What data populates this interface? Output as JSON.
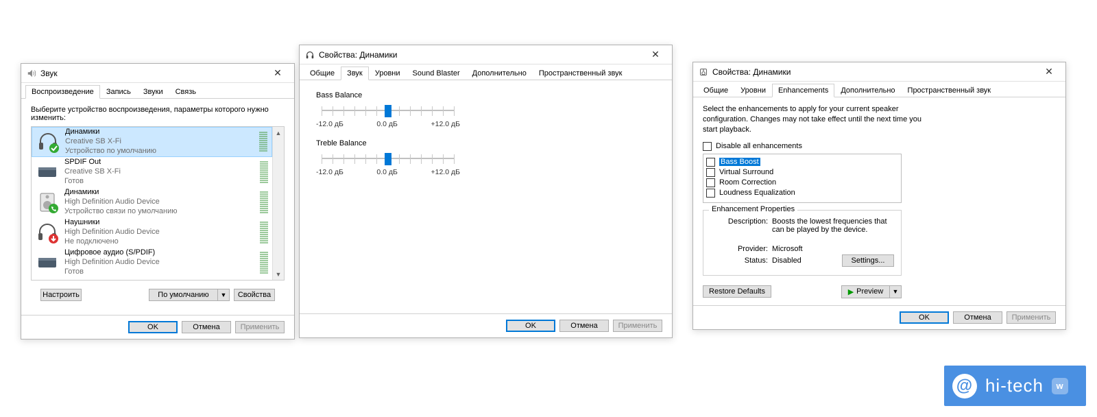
{
  "sound": {
    "title": "Звук",
    "tabs": [
      "Воспроизведение",
      "Запись",
      "Звуки",
      "Связь"
    ],
    "active_tab": 0,
    "instruction": "Выберите устройство воспроизведения, параметры которого нужно изменить:",
    "devices": [
      {
        "name": "Динамики",
        "sub1": "Creative SB X-Fi",
        "sub2": "Устройство по умолчанию",
        "selected": true,
        "kind": "headphones",
        "badge": "check"
      },
      {
        "name": "SPDIF Out",
        "sub1": "Creative SB X-Fi",
        "sub2": "Готов",
        "selected": false,
        "kind": "box",
        "badge": "none"
      },
      {
        "name": "Динамики",
        "sub1": "High Definition Audio Device",
        "sub2": "Устройство связи по умолчанию",
        "selected": false,
        "kind": "speaker",
        "badge": "phone"
      },
      {
        "name": "Наушники",
        "sub1": "High Definition Audio Device",
        "sub2": "Не подключено",
        "selected": false,
        "kind": "headphones",
        "badge": "down"
      },
      {
        "name": "Цифровое аудио (S/PDIF)",
        "sub1": "High Definition Audio Device",
        "sub2": "Готов",
        "selected": false,
        "kind": "box",
        "badge": "none"
      }
    ],
    "buttons": {
      "configure": "Настроить",
      "default": "По умолчанию",
      "properties": "Свойства"
    },
    "bottom": {
      "ok": "OK",
      "cancel": "Отмена",
      "apply": "Применить"
    }
  },
  "props_sound": {
    "title": "Свойства: Динамики",
    "tabs": [
      "Общие",
      "Звук",
      "Уровни",
      "Sound Blaster",
      "Дополнительно",
      "Пространственный звук"
    ],
    "active_tab": 1,
    "sliders": [
      {
        "label": "Bass Balance",
        "min": "-12.0 дБ",
        "mid": "0.0 дБ",
        "max": "+12.0 дБ"
      },
      {
        "label": "Treble Balance",
        "min": "-12.0 дБ",
        "mid": "0.0 дБ",
        "max": "+12.0 дБ"
      }
    ],
    "bottom": {
      "ok": "OK",
      "cancel": "Отмена",
      "apply": "Применить"
    }
  },
  "props_enh": {
    "title": "Свойства: Динамики",
    "tabs": [
      "Общие",
      "Уровни",
      "Enhancements",
      "Дополнительно",
      "Пространственный звук"
    ],
    "active_tab": 2,
    "instruction": "Select the enhancements to apply for your current speaker configuration. Changes may not take effect until the next time you start playback.",
    "disable_all": "Disable all enhancements",
    "items": [
      "Bass Boost",
      "Virtual Surround",
      "Room Correction",
      "Loudness Equalization"
    ],
    "selected_item": 0,
    "fieldset": {
      "legend": "Enhancement Properties",
      "desc_k": "Description:",
      "desc_v": "Boosts the lowest frequencies that can be played by the device.",
      "prov_k": "Provider:",
      "prov_v": "Microsoft",
      "stat_k": "Status:",
      "stat_v": "Disabled",
      "settings": "Settings..."
    },
    "restore": "Restore Defaults",
    "preview": "Preview",
    "bottom": {
      "ok": "OK",
      "cancel": "Отмена",
      "apply": "Применить"
    }
  },
  "watermark": "hi-tech"
}
